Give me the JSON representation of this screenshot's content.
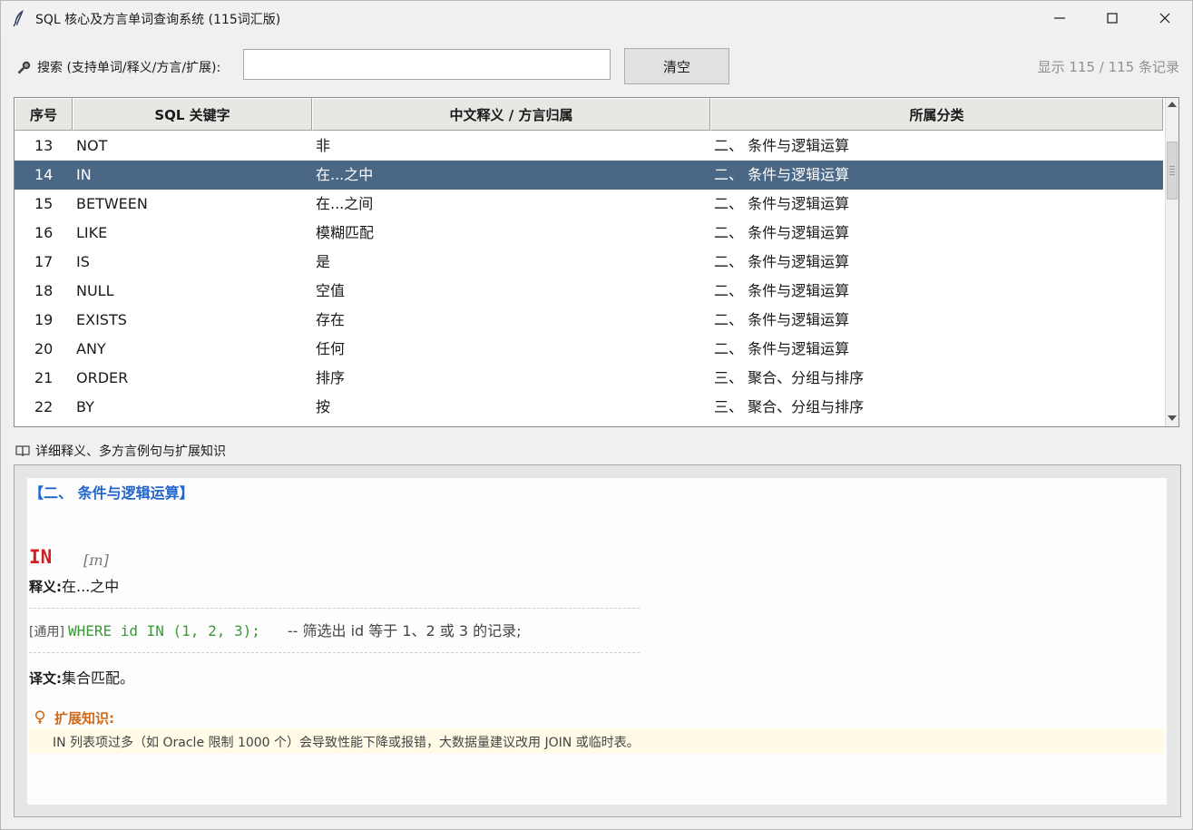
{
  "window": {
    "title": "SQL 核心及方言单词查询系统 (115词汇版)",
    "controls": [
      "minimize",
      "maximize",
      "close"
    ]
  },
  "search": {
    "label": "搜索 (支持单词/释义/方言/扩展):",
    "value": "",
    "placeholder": "",
    "clear_label": "清空",
    "record_count": "显示 115 / 115 条记录"
  },
  "table": {
    "columns": [
      "序号",
      "SQL 关键字",
      "中文释义 / 方言归属",
      "所属分类"
    ],
    "rows": [
      [
        "13",
        "NOT",
        "非",
        "二、 条件与逻辑运算"
      ],
      [
        "14",
        "IN",
        "在...之中",
        "二、 条件与逻辑运算"
      ],
      [
        "15",
        "BETWEEN",
        "在...之间",
        "二、 条件与逻辑运算"
      ],
      [
        "16",
        "LIKE",
        "模糊匹配",
        "二、 条件与逻辑运算"
      ],
      [
        "17",
        "IS",
        "是",
        "二、 条件与逻辑运算"
      ],
      [
        "18",
        "NULL",
        "空值",
        "二、 条件与逻辑运算"
      ],
      [
        "19",
        "EXISTS",
        "存在",
        "二、 条件与逻辑运算"
      ],
      [
        "20",
        "ANY",
        "任何",
        "二、 条件与逻辑运算"
      ],
      [
        "21",
        "ORDER",
        "排序",
        "三、 聚合、分组与排序"
      ],
      [
        "22",
        "BY",
        "按",
        "三、 聚合、分组与排序"
      ]
    ],
    "selected_row": "14"
  },
  "detail": {
    "header": "详细释义、多方言例句与扩展知识",
    "category": "【二、 条件与逻辑运算】",
    "keyword": "IN",
    "phonetic": "[ɪn]",
    "meaning_label": "释义:",
    "meaning": "在...之中",
    "example_tag": "[通用]",
    "example_code": "WHERE id IN (1, 2, 3);",
    "example_comment": "-- 筛选出 id 等于 1、2 或 3 的记录;",
    "translation_label": "译文:",
    "translation": "集合匹配。",
    "extension_label": "扩展知识:",
    "extension_text": "IN 列表项过多（如 Oracle 限制 1000 个）会导致性能下降或报错，大数据量建议改用 JOIN 或临时表。"
  },
  "colors": {
    "selected_row": "#4a6785",
    "category_title": "#2266cc",
    "keyword": "#cc2222",
    "code": "#3a9a3a",
    "extension_label": "#d06a1a",
    "extension_bg": "#fffbe7"
  },
  "icons": [
    "feather-icon",
    "minimize-icon",
    "maximize-icon",
    "close-icon",
    "search-icon",
    "scroll-up-icon",
    "scroll-down-icon",
    "book-icon",
    "lightbulb-icon"
  ]
}
